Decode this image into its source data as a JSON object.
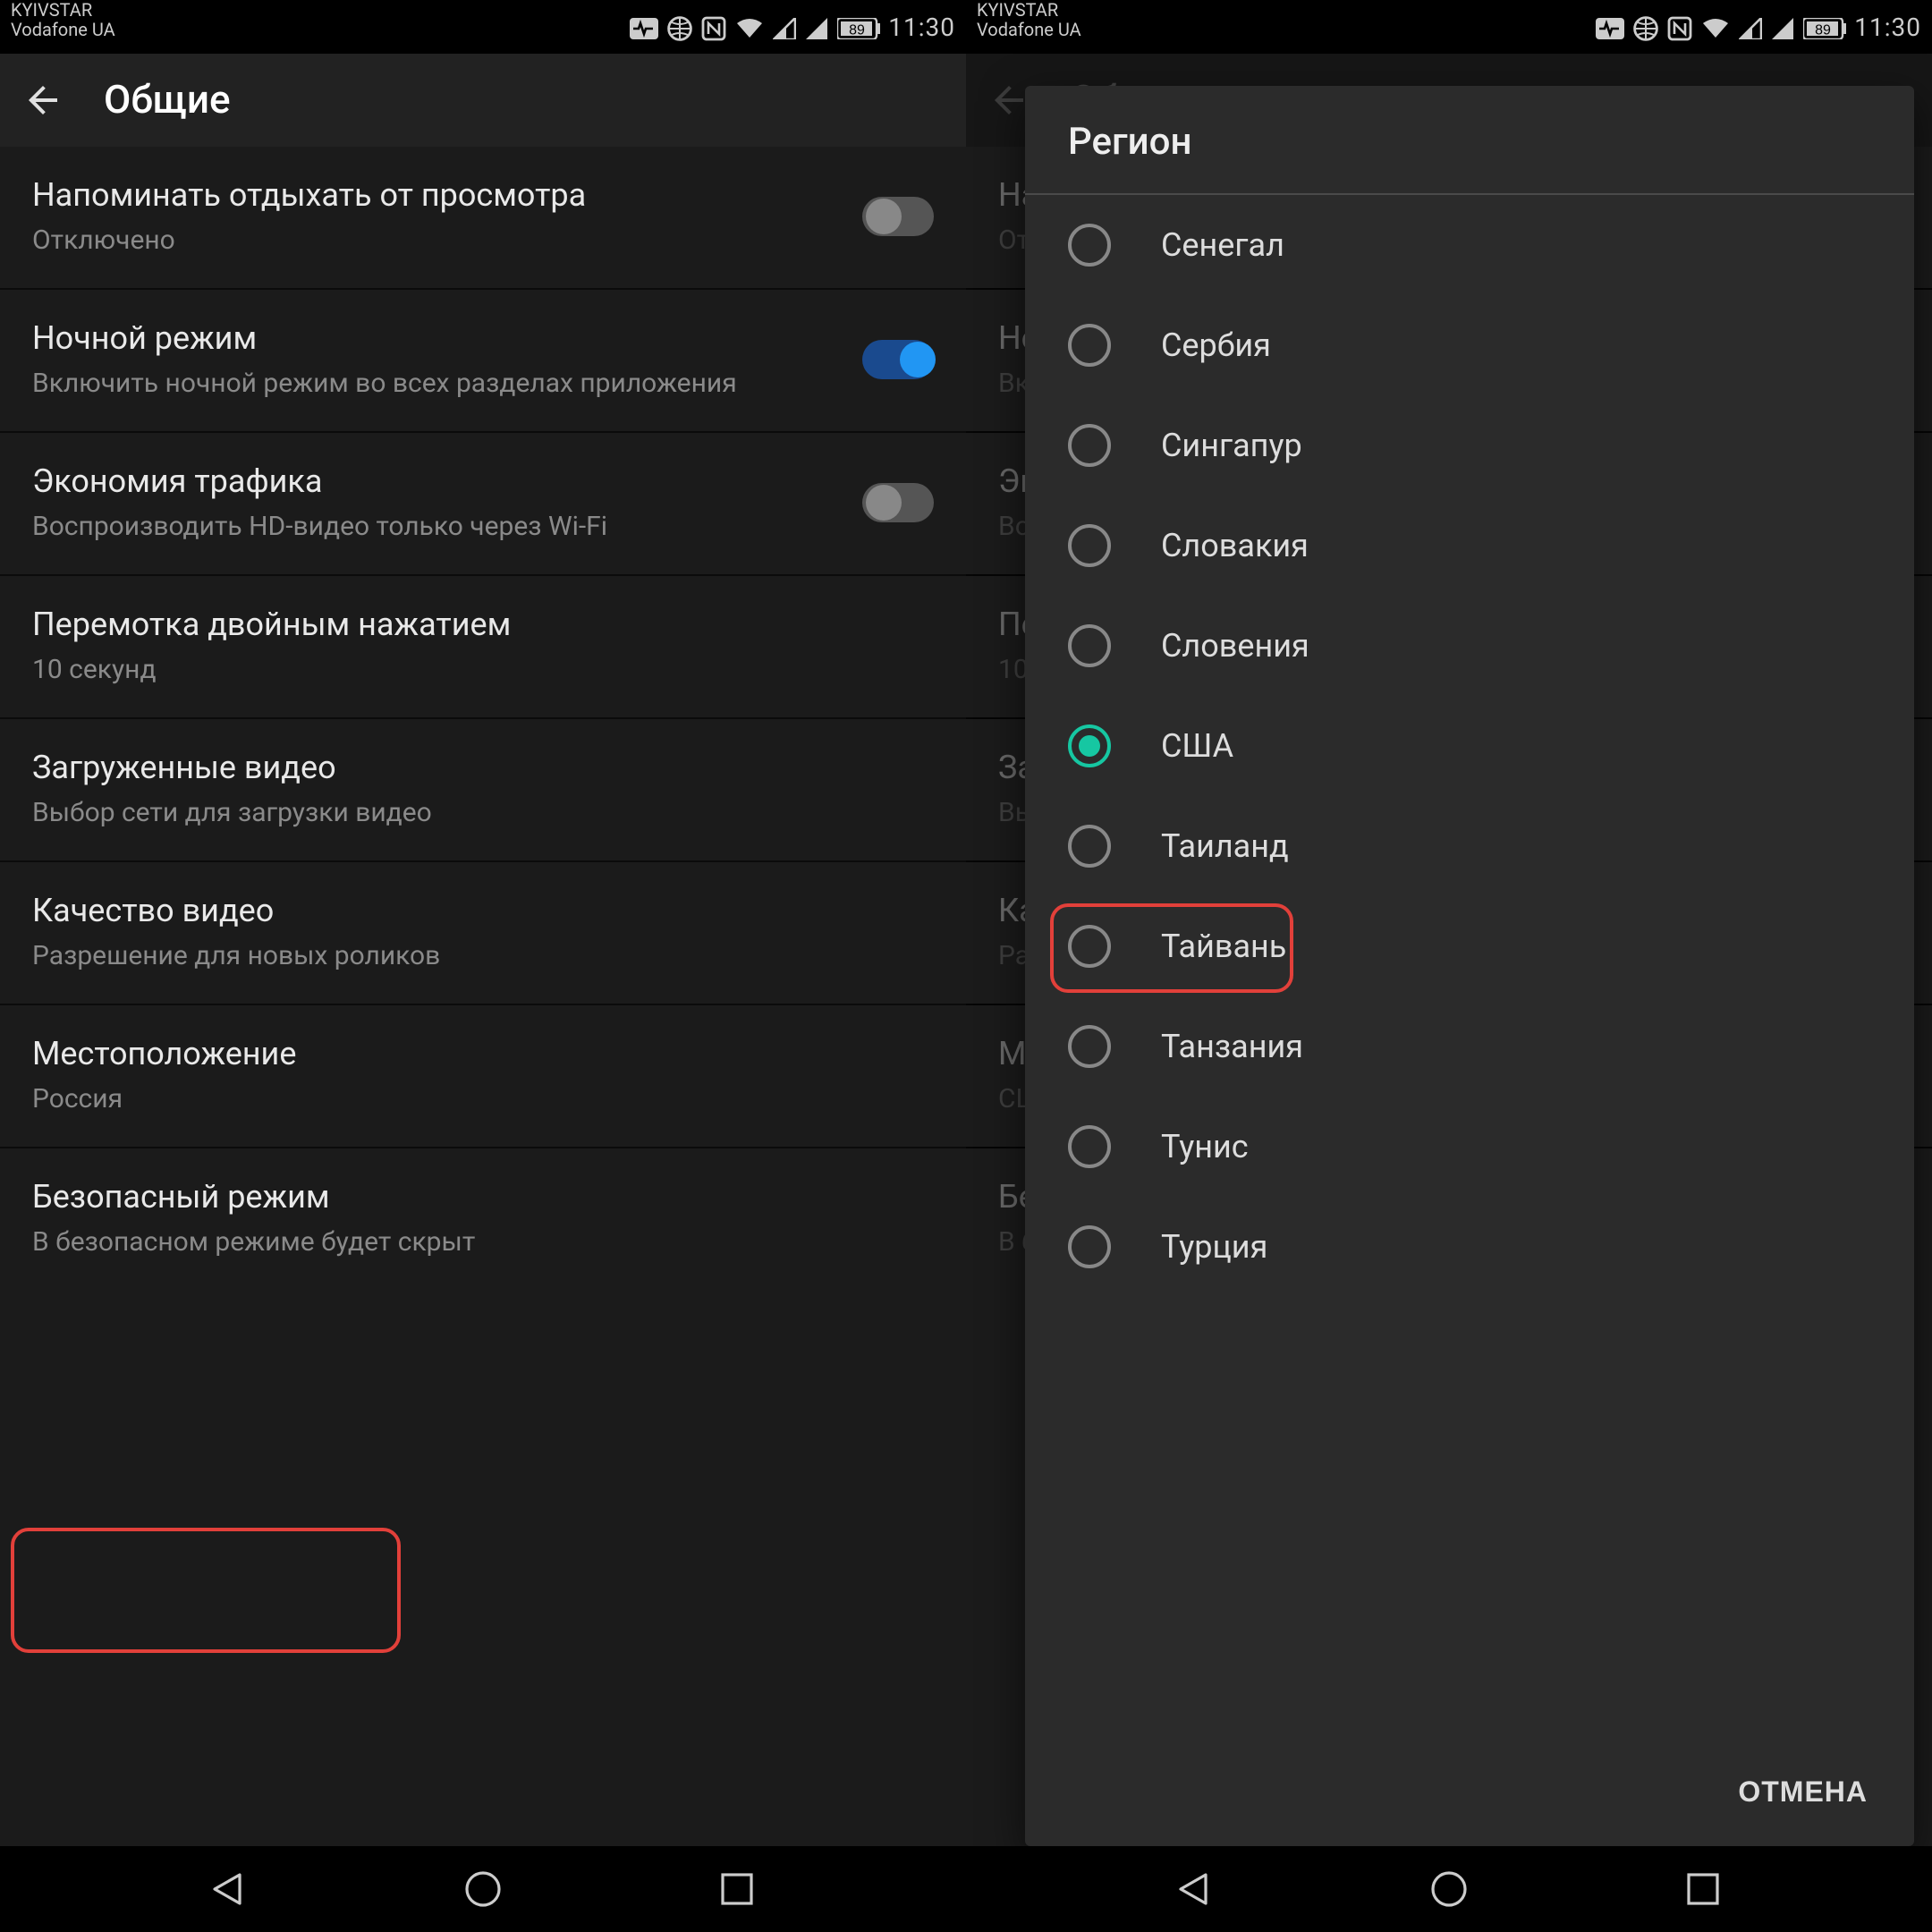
{
  "status": {
    "carrier1": "KYIVSTAR",
    "carrier2": "Vodafone UA",
    "battery": "89",
    "time": "11:30"
  },
  "appbar": {
    "title": "Общие"
  },
  "settings": [
    {
      "title": "Напоминать отдыхать от просмотра",
      "subtitle": "Отключено",
      "toggle": "off"
    },
    {
      "title": "Ночной режим",
      "subtitle": "Включить ночной режим во всех разделах приложения",
      "toggle": "on"
    },
    {
      "title": "Экономия трафика",
      "subtitle": "Воспроизводить HD-видео только через Wi-Fi",
      "toggle": "off"
    },
    {
      "title": "Перемотка двойным нажатием",
      "subtitle": "10 секунд"
    },
    {
      "title": "Загруженные видео",
      "subtitle": "Выбор сети для загрузки видео"
    },
    {
      "title": "Качество видео",
      "subtitle": "Разрешение для новых роликов"
    },
    {
      "title": "Местоположение",
      "subtitle": "Россия"
    },
    {
      "title": "Безопасный режим",
      "subtitle": "В безопасном режиме будет скрыт"
    }
  ],
  "settings_right_loc_subtitle": "США",
  "dialog": {
    "title": "Регион",
    "options": [
      {
        "label": "Сенегал",
        "selected": false
      },
      {
        "label": "Сербия",
        "selected": false
      },
      {
        "label": "Сингапур",
        "selected": false
      },
      {
        "label": "Словакия",
        "selected": false
      },
      {
        "label": "Словения",
        "selected": false
      },
      {
        "label": "США",
        "selected": true
      },
      {
        "label": "Таиланд",
        "selected": false
      },
      {
        "label": "Тайвань",
        "selected": false
      },
      {
        "label": "Танзания",
        "selected": false
      },
      {
        "label": "Тунис",
        "selected": false
      },
      {
        "label": "Турция",
        "selected": false
      }
    ],
    "cancel": "ОТМЕНА"
  }
}
